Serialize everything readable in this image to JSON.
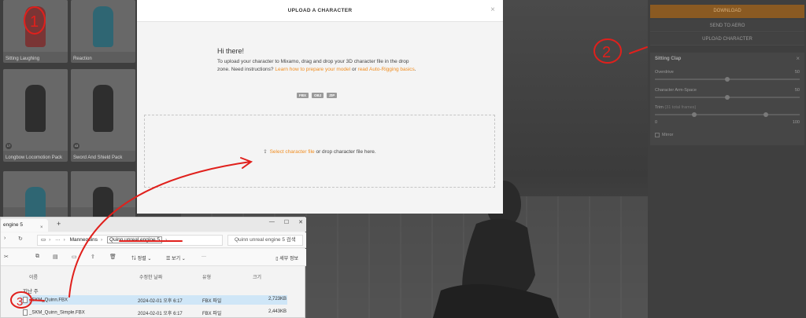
{
  "library": {
    "cards": [
      {
        "name": "Sitting Laughing",
        "badge": ""
      },
      {
        "name": "Reaction",
        "badge": ""
      },
      {
        "name": "Longbow Locomotion Pack",
        "badge": "17"
      },
      {
        "name": "Sword And Shield Pack",
        "badge": "43"
      },
      {
        "name": "",
        "badge": ""
      },
      {
        "name": "",
        "badge": ""
      }
    ]
  },
  "right_panel": {
    "download_label": "DOWNLOAD",
    "send_label": "SEND TO AERO",
    "upload_label": "UPLOAD CHARACTER",
    "settings": {
      "title": "Sitting Clap",
      "overdrive_label": "Overdrive",
      "overdrive_value": "50",
      "arm_space_label": "Character Arm-Space",
      "arm_space_value": "50",
      "trim_label": "Trim",
      "trim_sub": "(31 total frames)",
      "trim_min": "0",
      "trim_max": "100",
      "mirror_label": "Mirror"
    }
  },
  "modal": {
    "title": "UPLOAD A CHARACTER",
    "close": "×",
    "greeting": "Hi there!",
    "intro_text": "To upload your character to Mixamo, drag and drop your 3D character file in the drop zone. Need instructions?",
    "link_prepare": "Learn how to prepare your model",
    "intro_or": "or",
    "link_autorig": "read Auto-Rigging basics",
    "intro_end": ".",
    "formats": [
      "FBX",
      "OBJ",
      "ZIP"
    ],
    "dropzone_link": "Select character file",
    "dropzone_text": "or drop character file here."
  },
  "explorer": {
    "tab_title": "engine 5",
    "tab_close": "×",
    "new_tab": "+",
    "breadcrumb_more": "···",
    "breadcrumb_parent": "Mannequins",
    "breadcrumb_current": "Quinn unreal engine 5",
    "search_placeholder": "Quinn unreal engine 5 검색",
    "toolbar": {
      "sort_label": "정렬",
      "view_label": "보기",
      "more": "···",
      "details_label": "세부 정보"
    },
    "columns": {
      "name": "이름",
      "modified": "수정한 날짜",
      "type": "유형",
      "size": "크기"
    },
    "group_label": "지난 주",
    "files": [
      {
        "name": "_SKM_Quinn.FBX",
        "modified": "2024-02-01 오후 6:17",
        "type": "FBX 파일",
        "size": "2,723KB",
        "selected": true
      },
      {
        "name": "_SKM_Quinn_Simple.FBX",
        "modified": "2024-02-01 오후 6:17",
        "type": "FBX 파일",
        "size": "2,443KB",
        "selected": false
      }
    ]
  },
  "annotations": {
    "marker_1": "1",
    "marker_2": "2",
    "marker_3": "3",
    "color": "#e0201c"
  },
  "colors": {
    "accent": "#f08c1e",
    "selection": "#cfe6f7"
  }
}
